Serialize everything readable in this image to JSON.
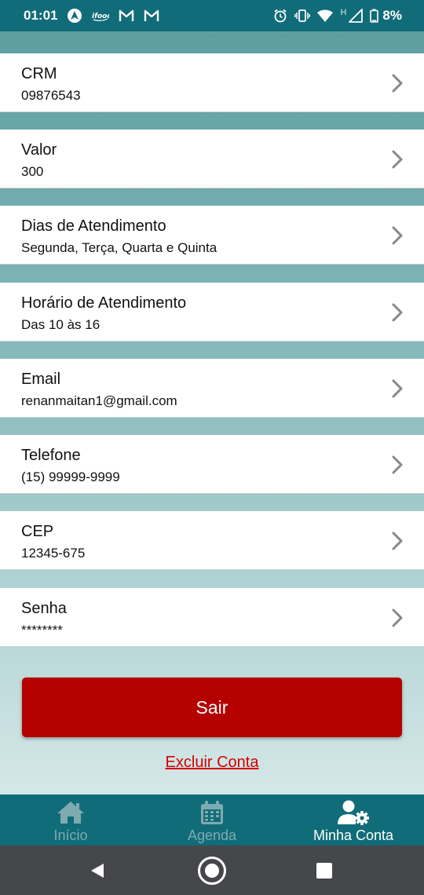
{
  "status_bar": {
    "time": "01:01",
    "battery": "8%",
    "network_type": "H",
    "left_icons": [
      "navigation-app-icon",
      "ifood-icon",
      "gmail-icon",
      "gmail-icon"
    ],
    "right_icons": [
      "alarm-icon",
      "vibrate-icon",
      "wifi-icon",
      "signal-icon",
      "battery-icon"
    ]
  },
  "fields": [
    {
      "title": "CRM",
      "value": "09876543"
    },
    {
      "title": "Valor",
      "value": "300"
    },
    {
      "title": "Dias de Atendimento",
      "value": "Segunda, Terça, Quarta e Quinta"
    },
    {
      "title": "Horário de Atendimento",
      "value": "Das 10 às 16"
    },
    {
      "title": "Email",
      "value": "renanmaitan1@gmail.com"
    },
    {
      "title": "Telefone",
      "value": "(15) 99999-9999"
    },
    {
      "title": "CEP",
      "value": "12345-675"
    },
    {
      "title": "Senha",
      "value": "********"
    }
  ],
  "actions": {
    "sair_label": "Sair",
    "excluir_label": "Excluir Conta"
  },
  "tabs": [
    {
      "label": "Início",
      "icon": "home-icon",
      "active": false
    },
    {
      "label": "Agenda",
      "icon": "calendar-icon",
      "active": false
    },
    {
      "label": "Minha Conta",
      "icon": "user-settings-icon",
      "active": true
    }
  ],
  "colors": {
    "header": "#106c78",
    "sair_button": "#b50000",
    "excluir_link": "#d40000",
    "tab_inactive": "#7faab0",
    "tab_active": "#ffffff"
  }
}
